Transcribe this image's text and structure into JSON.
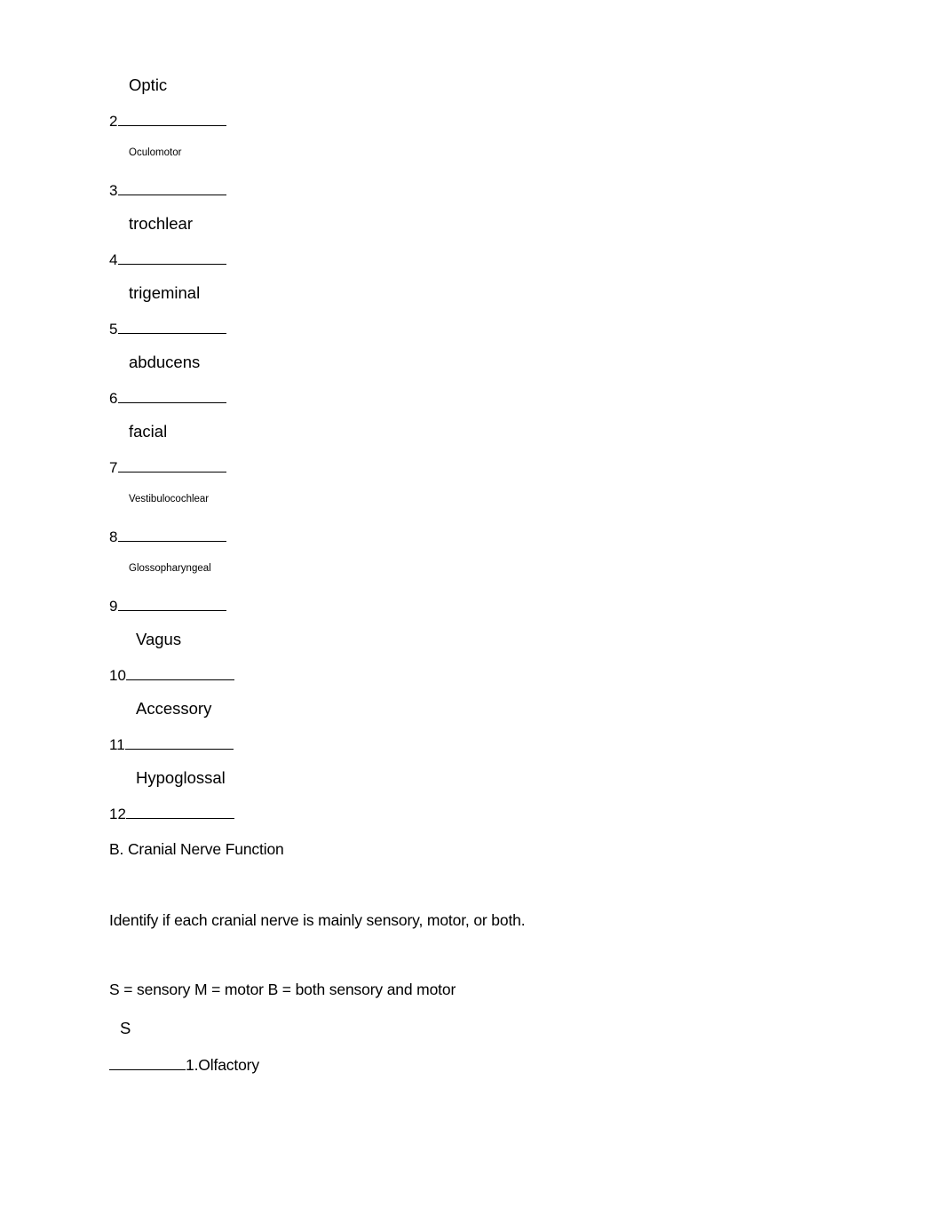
{
  "document": {
    "page_background": "#ffffff",
    "text_color": "#000000"
  },
  "nerve_blanks": {
    "items": [
      {
        "number": "2",
        "answer": "Optic",
        "answer_size": "large",
        "rule_width": 122
      },
      {
        "number": "3",
        "answer": "Oculomotor",
        "answer_size": "small",
        "rule_width": 122
      },
      {
        "number": "4",
        "answer": "trochlear",
        "answer_size": "large",
        "rule_width": 122
      },
      {
        "number": "5",
        "answer": "trigeminal",
        "answer_size": "large",
        "rule_width": 122
      },
      {
        "number": "6",
        "answer": "abducens",
        "answer_size": "large",
        "rule_width": 122
      },
      {
        "number": "7",
        "answer": "facial",
        "answer_size": "large",
        "rule_width": 122
      },
      {
        "number": "8",
        "answer": "Vestibulocochlear",
        "answer_size": "small",
        "rule_width": 122
      },
      {
        "number": "9",
        "answer": "Glossopharyngeal",
        "answer_size": "small",
        "rule_width": 122
      },
      {
        "number": "10",
        "answer": "Vagus",
        "answer_size": "large",
        "rule_width": 122
      },
      {
        "number": "11",
        "answer": "Accessory",
        "answer_size": "large",
        "rule_width": 122
      },
      {
        "number": "12",
        "answer": "Hypoglossal",
        "answer_size": "large",
        "rule_width": 122
      }
    ]
  },
  "section_b": {
    "heading": "B. Cranial Nerve Function",
    "instruction": "Identify if each cranial nerve is mainly sensory, motor, or both.",
    "legend": "S = sensory M = motor B = both sensory and motor"
  },
  "function_answers": {
    "items": [
      {
        "answer": "S",
        "label": "1.Olfactory"
      }
    ]
  }
}
